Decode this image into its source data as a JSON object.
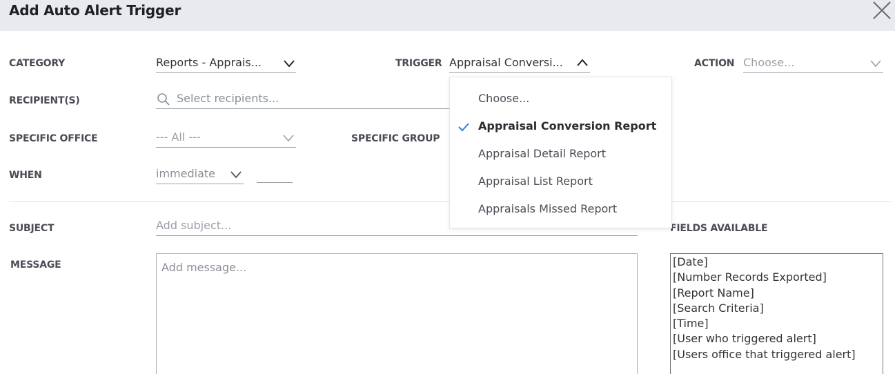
{
  "dialog": {
    "title": "Add Auto Alert Trigger"
  },
  "form": {
    "category": {
      "label": "CATEGORY",
      "value": "Reports - Apprais..."
    },
    "trigger": {
      "label": "TRIGGER",
      "value": "Appraisal Conversi..."
    },
    "action": {
      "label": "ACTION",
      "placeholder": "Choose..."
    },
    "recipients": {
      "label": "RECIPIENT(S)",
      "placeholder": "Select recipients..."
    },
    "specific_office": {
      "label": "SPECIFIC OFFICE",
      "value": "--- All ---"
    },
    "specific_group": {
      "label": "SPECIFIC GROUP"
    },
    "when": {
      "label": "WHEN",
      "value": "immediate",
      "amount": ""
    },
    "subject": {
      "label": "SUBJECT",
      "placeholder": "Add subject..."
    },
    "message": {
      "label": "MESSAGE",
      "placeholder": "Add message..."
    },
    "fields_available": {
      "label": "FIELDS AVAILABLE",
      "items": [
        "[Date]",
        "[Number Records Exported]",
        "[Report Name]",
        "[Search Criteria]",
        "[Time]",
        "[User who triggered alert]",
        "[Users office that triggered alert]"
      ]
    }
  },
  "trigger_dropdown": {
    "options": [
      "Choose...",
      "Appraisal Conversion Report",
      "Appraisal Detail Report",
      "Appraisal List Report",
      "Appraisals Missed Report"
    ],
    "selected": "Appraisal Conversion Report"
  },
  "icons": {
    "close": "close-icon",
    "chevron": "chevron-down-icon",
    "chevron_up": "chevron-up-icon",
    "search": "search-icon",
    "check": "check-icon"
  },
  "colors": {
    "accent": "#2f7de1",
    "header_bg": "#e8eaed"
  }
}
